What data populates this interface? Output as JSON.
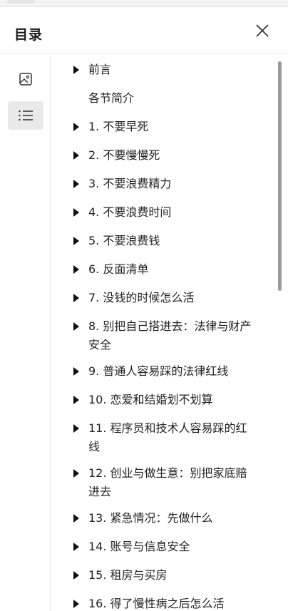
{
  "panel": {
    "title": "目录"
  },
  "toc": {
    "items": [
      {
        "label": "前言",
        "expandable": true
      },
      {
        "label": "各节简介",
        "expandable": false
      },
      {
        "label": "1. 不要早死",
        "expandable": true
      },
      {
        "label": "2. 不要慢慢死",
        "expandable": true
      },
      {
        "label": "3. 不要浪费精力",
        "expandable": true
      },
      {
        "label": "4. 不要浪费时间",
        "expandable": true
      },
      {
        "label": "5. 不要浪费钱",
        "expandable": true
      },
      {
        "label": "6. 反面清单",
        "expandable": true
      },
      {
        "label": "7. 没钱的时候怎么活",
        "expandable": true
      },
      {
        "label": "8. 别把自己搭进去：法律与财产安全",
        "expandable": true
      },
      {
        "label": "9. 普通人容易踩的法律红线",
        "expandable": true
      },
      {
        "label": "10. 恋爱和结婚划不划算",
        "expandable": true
      },
      {
        "label": "11. 程序员和技术人容易踩的红线",
        "expandable": true
      },
      {
        "label": "12. 创业与做生意：别把家底赔进去",
        "expandable": true
      },
      {
        "label": "13. 紧急情况：先做什么",
        "expandable": true
      },
      {
        "label": "14. 账号与信息安全",
        "expandable": true
      },
      {
        "label": "15. 租房与买房",
        "expandable": true
      },
      {
        "label": "16. 得了慢性病之后怎么活",
        "expandable": true
      }
    ]
  },
  "icons": {
    "close": "close-icon",
    "image": "image-icon",
    "list": "list-icon",
    "expand": "caret-right-icon"
  },
  "colors": {
    "active_rail_bg": "#e9e9e9",
    "divider": "#e8e8e8",
    "scrollbar": "#9a9a9a"
  }
}
